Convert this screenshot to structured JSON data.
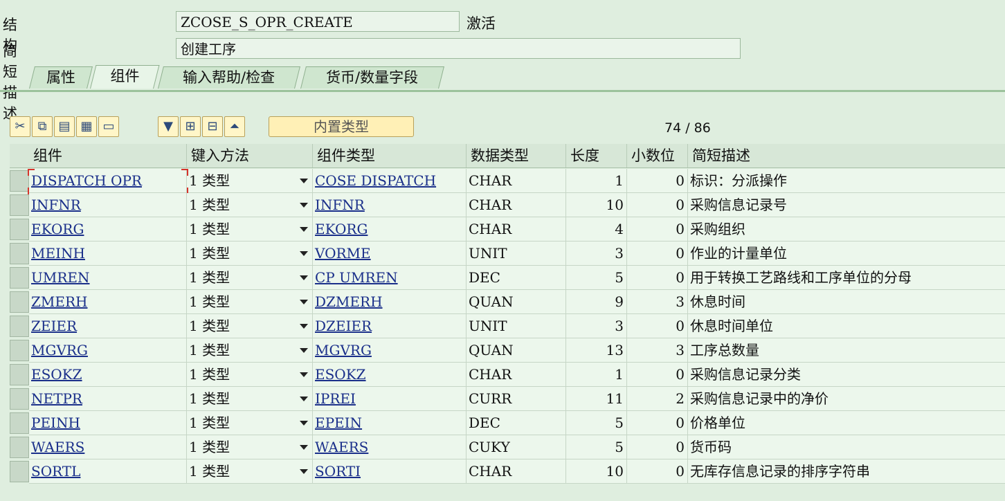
{
  "header": {
    "structure_label": "结构",
    "structure_value": "ZCOSE_S_OPR_CREATE",
    "status": "激活",
    "desc_label": "简短描述",
    "desc_value": "创建工序"
  },
  "tabs": [
    {
      "label": "属性",
      "active": false
    },
    {
      "label": "组件",
      "active": true
    },
    {
      "label": "输入帮助/检查",
      "active": false
    },
    {
      "label": "货币/数量字段",
      "active": false
    }
  ],
  "toolbar": {
    "icons": [
      "cut-icon",
      "copy-icon",
      "paste-icon",
      "insert-row-icon",
      "delete-row-icon",
      "filter-icon",
      "table-icon",
      "table-append-icon",
      "collapse-up-icon"
    ],
    "builtin_type_label": "内置类型"
  },
  "counter": "74 / 86",
  "columns": [
    "组件",
    "键入方法",
    "组件类型",
    "数据类型",
    "长度",
    "小数位",
    "简短描述"
  ],
  "rows": [
    {
      "component": "DISPATCH OPR",
      "method": "1 类型",
      "type": "COSE DISPATCH",
      "dtype": "CHAR",
      "length": "1",
      "decimals": "0",
      "desc": "标识：分派操作"
    },
    {
      "component": "INFNR",
      "method": "1 类型",
      "type": "INFNR",
      "dtype": "CHAR",
      "length": "10",
      "decimals": "0",
      "desc": "采购信息记录号"
    },
    {
      "component": "EKORG",
      "method": "1 类型",
      "type": "EKORG",
      "dtype": "CHAR",
      "length": "4",
      "decimals": "0",
      "desc": "采购组织"
    },
    {
      "component": "MEINH",
      "method": "1 类型",
      "type": "VORME",
      "dtype": "UNIT",
      "length": "3",
      "decimals": "0",
      "desc": "作业的计量单位"
    },
    {
      "component": "UMREN",
      "method": "1 类型",
      "type": "CP UMREN",
      "dtype": "DEC",
      "length": "5",
      "decimals": "0",
      "desc": "用于转换工艺路线和工序单位的分母"
    },
    {
      "component": "ZMERH",
      "method": "1 类型",
      "type": "DZMERH",
      "dtype": "QUAN",
      "length": "9",
      "decimals": "3",
      "desc": "休息时间"
    },
    {
      "component": "ZEIER",
      "method": "1 类型",
      "type": "DZEIER",
      "dtype": "UNIT",
      "length": "3",
      "decimals": "0",
      "desc": "休息时间单位"
    },
    {
      "component": "MGVRG",
      "method": "1 类型",
      "type": "MGVRG",
      "dtype": "QUAN",
      "length": "13",
      "decimals": "3",
      "desc": "工序总数量"
    },
    {
      "component": "ESOKZ",
      "method": "1 类型",
      "type": "ESOKZ",
      "dtype": "CHAR",
      "length": "1",
      "decimals": "0",
      "desc": "采购信息记录分类"
    },
    {
      "component": "NETPR",
      "method": "1 类型",
      "type": "IPREI",
      "dtype": "CURR",
      "length": "11",
      "decimals": "2",
      "desc": "采购信息记录中的净价"
    },
    {
      "component": "PEINH",
      "method": "1 类型",
      "type": "EPEIN",
      "dtype": "DEC",
      "length": "5",
      "decimals": "0",
      "desc": "价格单位"
    },
    {
      "component": "WAERS",
      "method": "1 类型",
      "type": "WAERS",
      "dtype": "CUKY",
      "length": "5",
      "decimals": "0",
      "desc": "货币码"
    },
    {
      "component": "SORTL",
      "method": "1 类型",
      "type": "SORTI",
      "dtype": "CHAR",
      "length": "10",
      "decimals": "0",
      "desc": "无库存信息记录的排序字符串"
    }
  ]
}
